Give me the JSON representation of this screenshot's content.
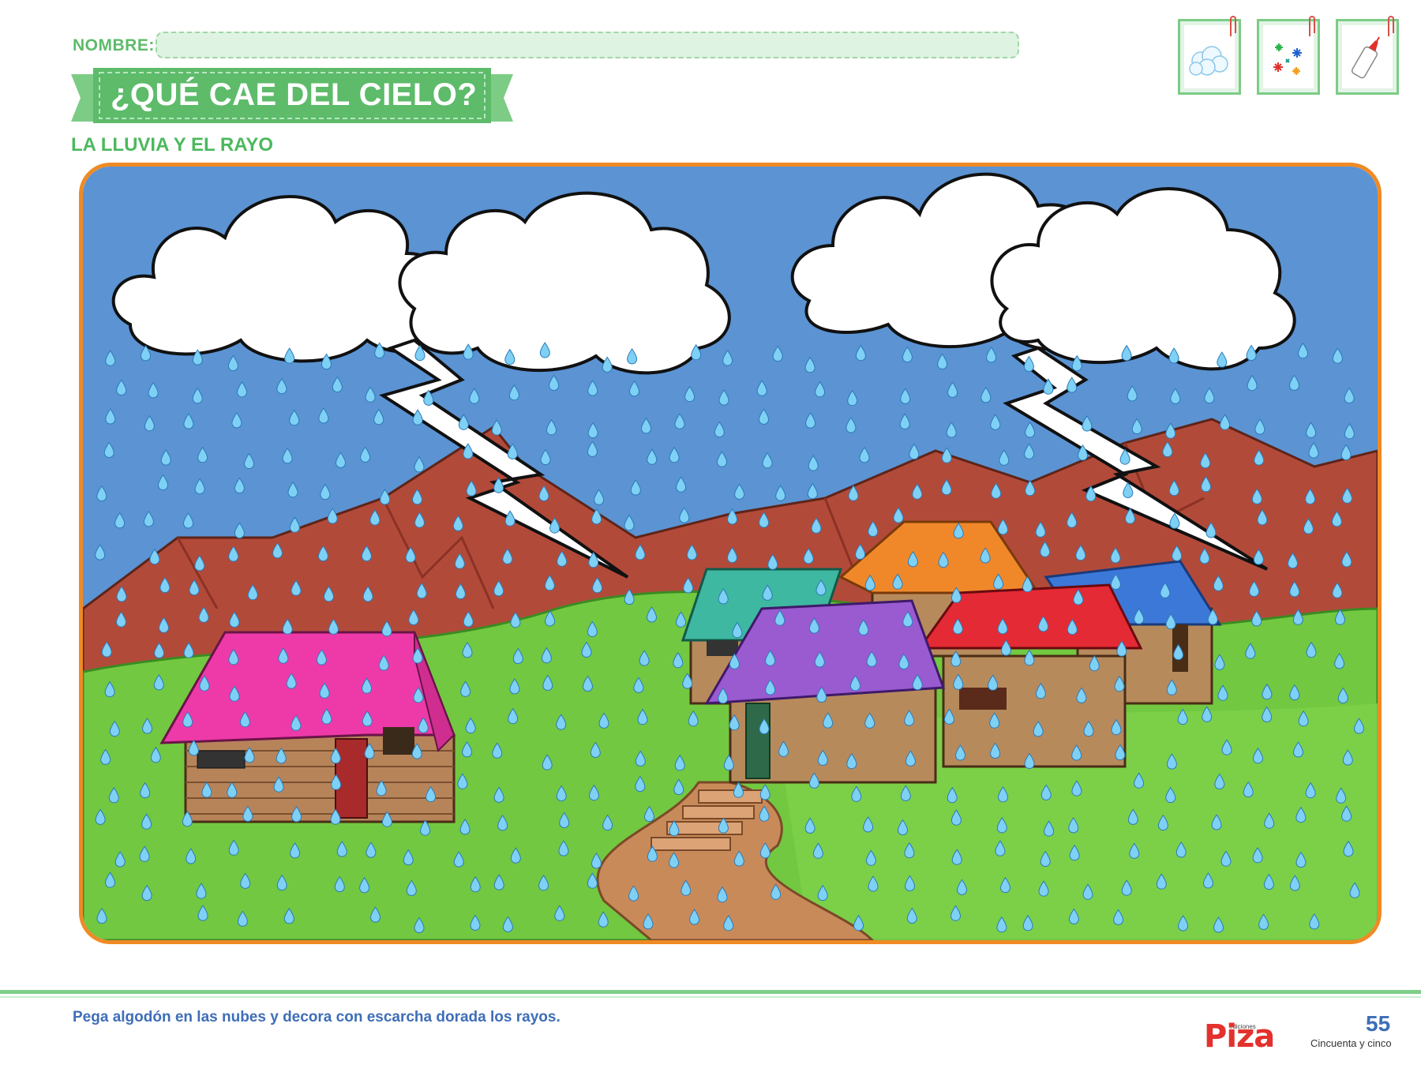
{
  "header": {
    "nombre_label": "NOMBRE:",
    "title": "¿QUÉ CAE DEL CIELO?",
    "subtitle": "LA LLUVIA Y EL RAYO"
  },
  "materials": [
    {
      "name": "cotton-balls-icon"
    },
    {
      "name": "glitter-icon"
    },
    {
      "name": "glue-bottle-icon"
    }
  ],
  "scene": {
    "description_icons": [
      "cloud-icon",
      "lightning-bolt-icon",
      "raindrop-icon",
      "mountain",
      "house"
    ]
  },
  "footer": {
    "instruction": "Pega algodón en las nubes y decora con escarcha dorada los rayos.",
    "brand_small": "ediciones",
    "brand": "Piza",
    "page_number": "55",
    "page_words": "Cincuenta y cinco"
  },
  "colors": {
    "green": "#5dbb6a",
    "blue_text": "#3e6eb8",
    "sky": "#5b93d3",
    "mountain": "#b24a3a",
    "grass": "#72c840",
    "frame": "#f08a24",
    "brand_red": "#e3312d",
    "drop": "#7fd0f5"
  }
}
